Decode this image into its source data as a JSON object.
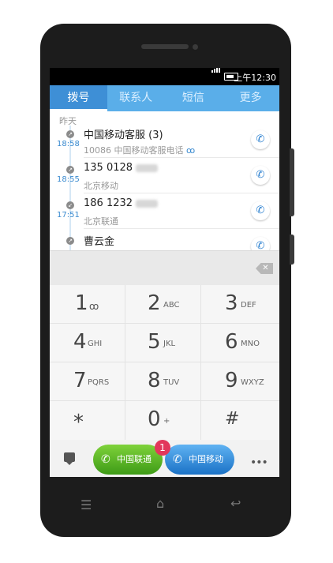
{
  "status": {
    "time": "上午12:30"
  },
  "tabs": [
    {
      "label": "拨号",
      "active": true
    },
    {
      "label": "联系人"
    },
    {
      "label": "短信"
    },
    {
      "label": "更多"
    }
  ],
  "calls": {
    "section": "昨天",
    "entries": [
      {
        "name": "中国移动客服 (3)",
        "sub": "10086  中国移动客服电话",
        "time": "18:58",
        "type": "outgoing"
      },
      {
        "name": "135 0128",
        "sub": "北京移动",
        "time": "18:55",
        "type": "outgoing"
      },
      {
        "name": "186 1232",
        "sub": "北京联通",
        "time": "17:51",
        "type": "incoming"
      },
      {
        "name": "曹云金",
        "sub": "",
        "time": "",
        "type": "outgoing"
      }
    ]
  },
  "keypad": {
    "keys": [
      {
        "digit": "1",
        "letters": "voicemail"
      },
      {
        "digit": "2",
        "letters": "ABC"
      },
      {
        "digit": "3",
        "letters": "DEF"
      },
      {
        "digit": "4",
        "letters": "GHI"
      },
      {
        "digit": "5",
        "letters": "JKL"
      },
      {
        "digit": "6",
        "letters": "MNO"
      },
      {
        "digit": "7",
        "letters": "PQRS"
      },
      {
        "digit": "8",
        "letters": "TUV"
      },
      {
        "digit": "9",
        "letters": "WXYZ"
      },
      {
        "digit": "*",
        "letters": ""
      },
      {
        "digit": "0",
        "letters": "+"
      },
      {
        "digit": "#",
        "letters": ""
      }
    ]
  },
  "bottom": {
    "sim1_label": "中国联通",
    "sim2_label": "中国移动",
    "badge_count": "1",
    "more": "•••"
  },
  "colors": {
    "accent": "#5aaee9",
    "sim1": "#4caa1f",
    "sim2": "#2d86d8",
    "badge": "#e2375b"
  }
}
